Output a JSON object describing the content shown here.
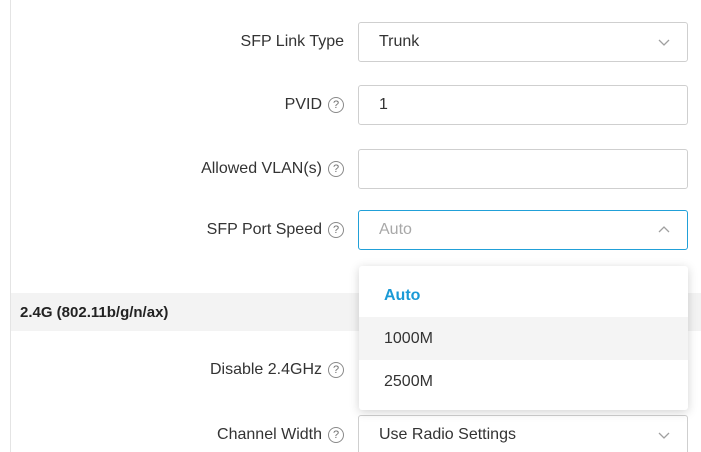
{
  "form": {
    "sfp_link_type": {
      "label": "SFP Link Type",
      "value": "Trunk"
    },
    "pvid": {
      "label": "PVID",
      "help": "?",
      "value": "1"
    },
    "allowed_vlans": {
      "label": "Allowed VLAN(s)",
      "help": "?",
      "value": ""
    },
    "sfp_port_speed": {
      "label": "SFP Port Speed",
      "help": "?",
      "value": "Auto",
      "options": [
        "Auto",
        "1000M",
        "2500M"
      ]
    }
  },
  "section": {
    "title": "2.4G (802.11b/g/n/ax)"
  },
  "radio": {
    "disable_24ghz": {
      "label": "Disable 2.4GHz",
      "help": "?"
    },
    "channel_width": {
      "label": "Channel Width",
      "help": "?",
      "value": "Use Radio Settings"
    }
  },
  "colors": {
    "accent": "#1a9ad6",
    "section_bg": "#f3f3f3"
  }
}
